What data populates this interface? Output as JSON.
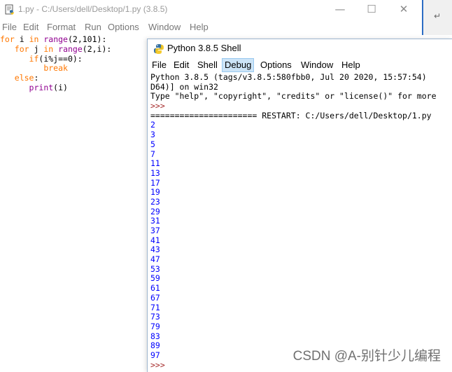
{
  "editor": {
    "title": "1.py - C:/Users/dell/Desktop/1.py (3.8.5)",
    "window_controls": {
      "minimize": "—",
      "maximize": "☐",
      "close": "✕"
    },
    "menu": [
      "File",
      "Edit",
      "Format",
      "Run",
      "Options",
      "Window",
      "Help"
    ],
    "code": [
      [
        {
          "t": "for",
          "c": "kw"
        },
        {
          "t": " i ",
          "c": "nm"
        },
        {
          "t": "in",
          "c": "kw"
        },
        {
          "t": " ",
          "c": "nm"
        },
        {
          "t": "range",
          "c": "bi"
        },
        {
          "t": "(2,101):",
          "c": "nm"
        }
      ],
      [
        {
          "t": "   ",
          "c": "nm"
        },
        {
          "t": "for",
          "c": "kw"
        },
        {
          "t": " j ",
          "c": "nm"
        },
        {
          "t": "in",
          "c": "kw"
        },
        {
          "t": " ",
          "c": "nm"
        },
        {
          "t": "range",
          "c": "bi"
        },
        {
          "t": "(2,i):",
          "c": "nm"
        }
      ],
      [
        {
          "t": "      ",
          "c": "nm"
        },
        {
          "t": "if",
          "c": "kw"
        },
        {
          "t": "(i%j==0):",
          "c": "nm"
        }
      ],
      [
        {
          "t": "         ",
          "c": "nm"
        },
        {
          "t": "break",
          "c": "kw"
        }
      ],
      [
        {
          "t": "   ",
          "c": "nm"
        },
        {
          "t": "else",
          "c": "kw"
        },
        {
          "t": ":",
          "c": "nm"
        }
      ],
      [
        {
          "t": "      ",
          "c": "nm"
        },
        {
          "t": "print",
          "c": "bi"
        },
        {
          "t": "(i)",
          "c": "nm"
        }
      ]
    ]
  },
  "shell": {
    "title": "Python 3.8.5 Shell",
    "menu": [
      "File",
      "Edit",
      "Shell",
      "Debug",
      "Options",
      "Window",
      "Help"
    ],
    "active_menu": "Debug",
    "header_lines": [
      "Python 3.8.5 (tags/v3.8.5:580fbb0, Jul 20 2020, 15:57:54)",
      "D64)] on win32",
      "Type \"help\", \"copyright\", \"credits\" or \"license()\" for more"
    ],
    "prompt": ">>>",
    "restart_line": "====================== RESTART: C:/Users/dell/Desktop/1.py",
    "output": [
      "2",
      "3",
      "5",
      "7",
      "11",
      "13",
      "17",
      "19",
      "23",
      "29",
      "31",
      "37",
      "41",
      "43",
      "47",
      "53",
      "59",
      "61",
      "67",
      "71",
      "73",
      "79",
      "83",
      "89",
      "97"
    ],
    "final_prompt": ">>>"
  },
  "watermark": "CSDN @A-别针少儿编程",
  "colors": {
    "keyword": "#ff7700",
    "builtin": "#900090",
    "output": "#0000ff",
    "prompt": "#a52a2a",
    "active_menu_bg": "#cce4f7"
  },
  "icons": [
    "python-file-icon",
    "python-shell-icon",
    "minimize-icon",
    "maximize-icon",
    "close-icon"
  ]
}
